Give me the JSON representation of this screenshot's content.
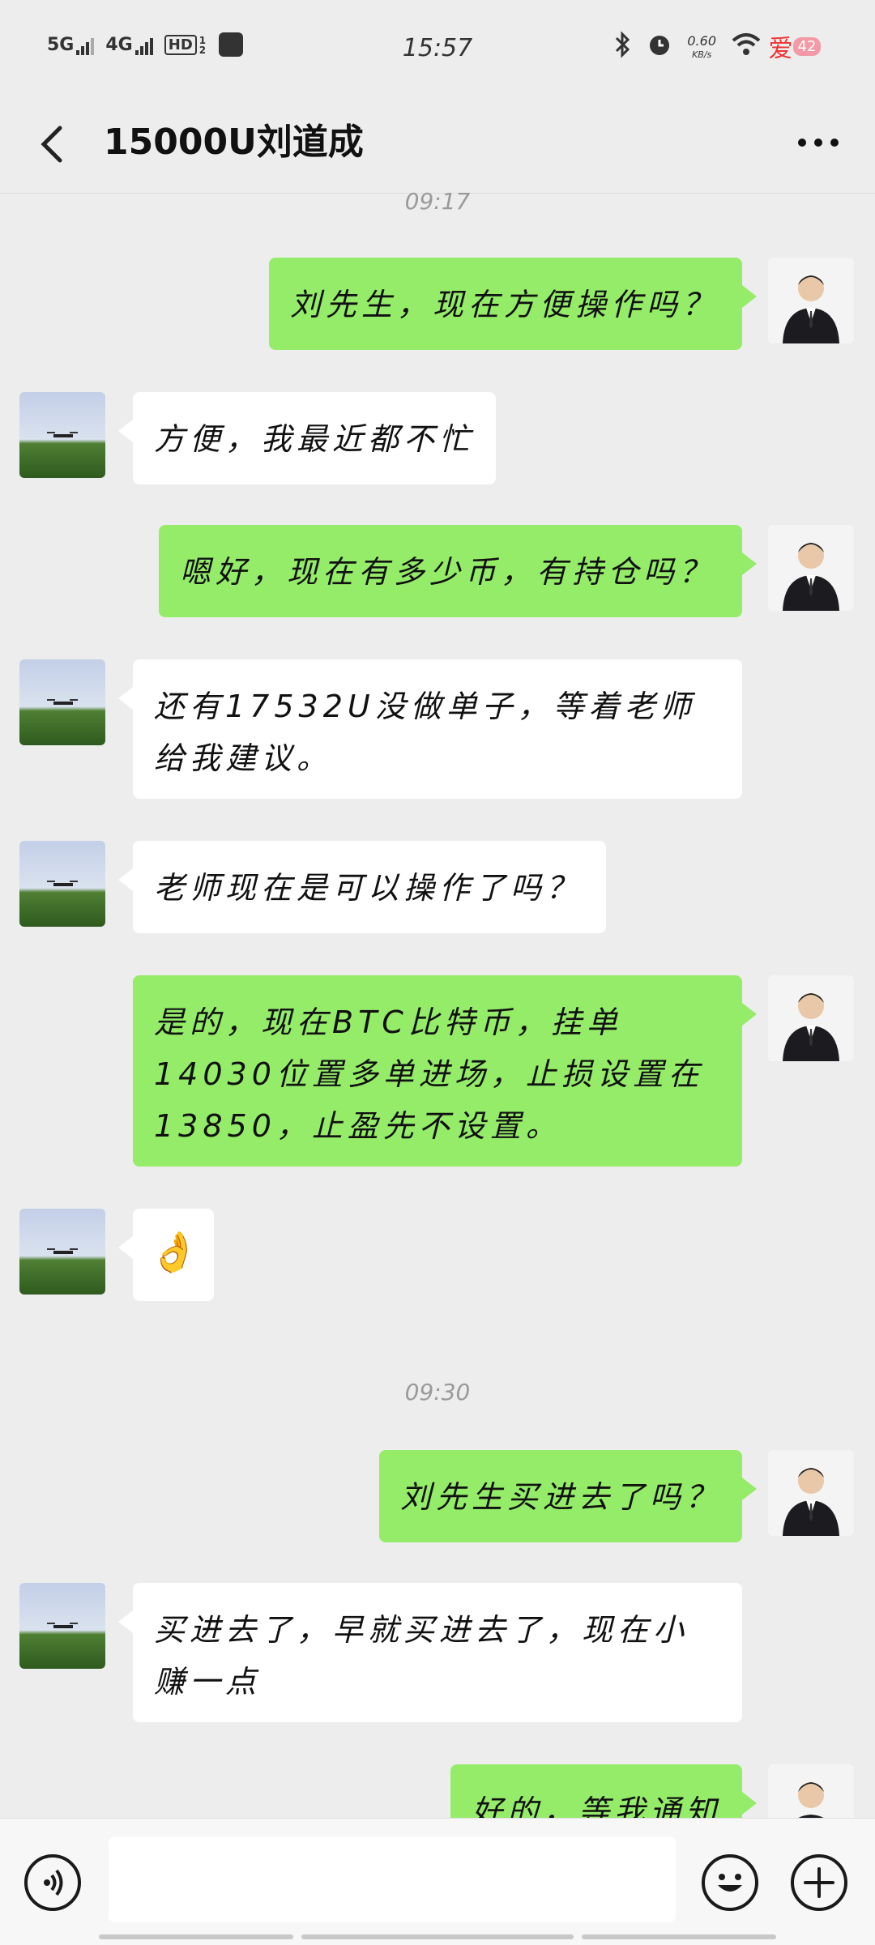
{
  "status_bar": {
    "network_1": "5G",
    "network_2": "4G",
    "hd_label": "HD",
    "hd_sub": "1 2",
    "time": "15:57",
    "speed_value": "0.60",
    "speed_unit": "KB/s",
    "battery": "42",
    "app_badge": "爱"
  },
  "header": {
    "title": "15000U刘道成",
    "back_icon": "chevron-left-icon",
    "more_icon": "more-horizontal-icon"
  },
  "messages": [
    {
      "type": "time",
      "text": "09:17"
    },
    {
      "type": "sent",
      "text": "刘先生，现在方便操作吗？"
    },
    {
      "type": "received",
      "text": "方便，我最近都不忙"
    },
    {
      "type": "sent",
      "text": "嗯好，现在有多少币，有持仓吗？"
    },
    {
      "type": "received",
      "text": "还有17532U没做单子，等着老师给我建议。"
    },
    {
      "type": "received",
      "text": "老师现在是可以操作了吗？"
    },
    {
      "type": "sent",
      "text": "是的，现在BTC比特币，挂单14030位置多单进场，止损设置在13850，止盈先不设置。"
    },
    {
      "type": "received",
      "text": "👌"
    },
    {
      "type": "time",
      "text": "09:30"
    },
    {
      "type": "sent",
      "text": "刘先生买进去了吗？"
    },
    {
      "type": "received",
      "text": "买进去了，早就买进去了，现在小赚一点"
    },
    {
      "type": "sent",
      "text": "好的，等我通知"
    }
  ],
  "input_bar": {
    "voice_icon": "voice-icon",
    "emoji_icon": "emoji-icon",
    "add_icon": "plus-icon"
  },
  "colors": {
    "background": "#ededed",
    "sent_bubble": "#95ec69",
    "received_bubble": "#ffffff"
  }
}
